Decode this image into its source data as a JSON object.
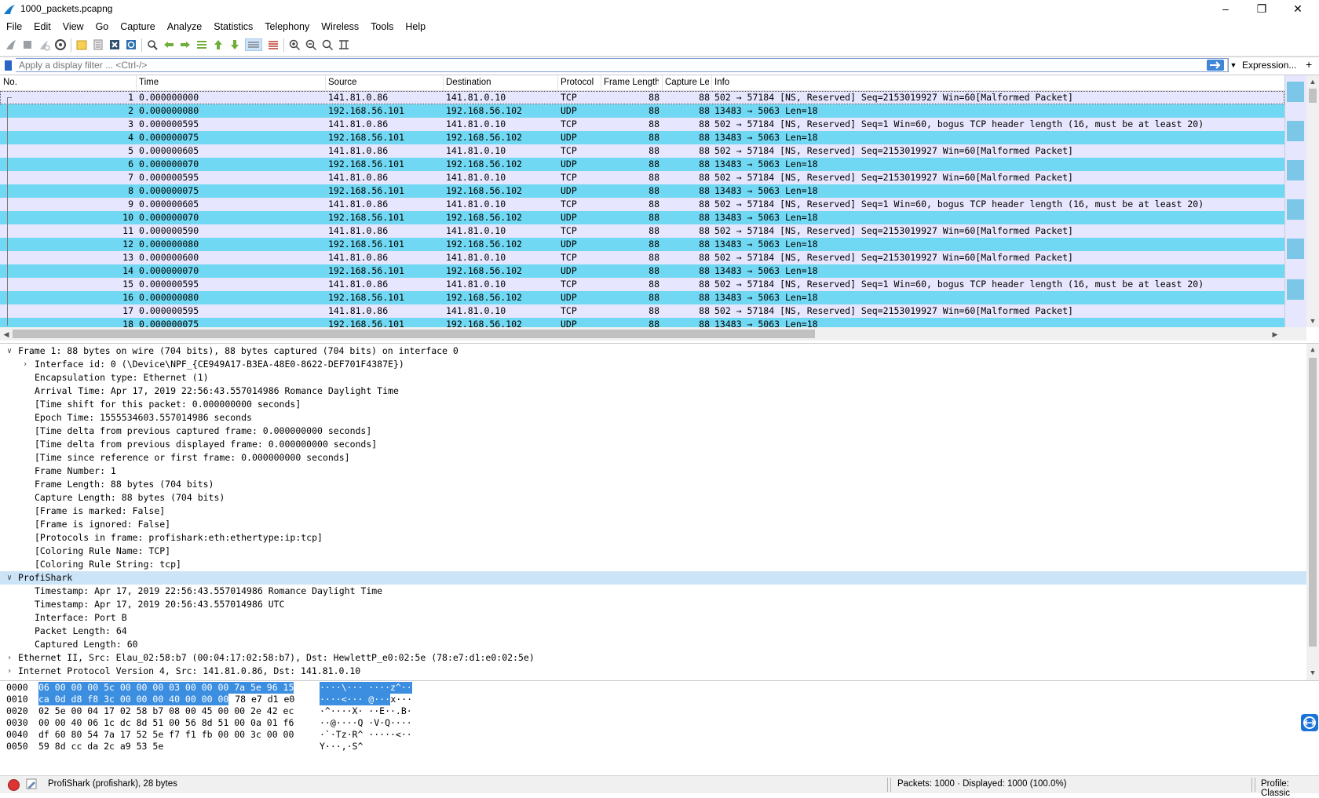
{
  "window": {
    "title": "1000_packets.pcapng"
  },
  "menu": [
    "File",
    "Edit",
    "View",
    "Go",
    "Capture",
    "Analyze",
    "Statistics",
    "Telephony",
    "Wireless",
    "Tools",
    "Help"
  ],
  "filter": {
    "placeholder": "Apply a display filter ... <Ctrl-/>",
    "expression_label": "Expression...",
    "plus_label": "+"
  },
  "packet_list": {
    "columns": [
      "No.",
      "Time",
      "Source",
      "Destination",
      "Protocol",
      "Frame Length",
      "Capture Le",
      "Info"
    ],
    "rows": [
      {
        "no": "1",
        "time": "0.000000000",
        "src": "141.81.0.86",
        "dst": "141.81.0.10",
        "proto": "TCP",
        "flen": "88",
        "clen": "88",
        "info": "502 → 57184 [NS, Reserved] Seq=2153019927 Win=60[Malformed Packet]"
      },
      {
        "no": "2",
        "time": "0.000000080",
        "src": "192.168.56.101",
        "dst": "192.168.56.102",
        "proto": "UDP",
        "flen": "88",
        "clen": "88",
        "info": "13483 → 5063 Len=18"
      },
      {
        "no": "3",
        "time": "0.000000595",
        "src": "141.81.0.86",
        "dst": "141.81.0.10",
        "proto": "TCP",
        "flen": "88",
        "clen": "88",
        "info": "502 → 57184 [NS, Reserved] Seq=1 Win=60, bogus TCP header length (16, must be at least 20)"
      },
      {
        "no": "4",
        "time": "0.000000075",
        "src": "192.168.56.101",
        "dst": "192.168.56.102",
        "proto": "UDP",
        "flen": "88",
        "clen": "88",
        "info": "13483 → 5063 Len=18"
      },
      {
        "no": "5",
        "time": "0.000000605",
        "src": "141.81.0.86",
        "dst": "141.81.0.10",
        "proto": "TCP",
        "flen": "88",
        "clen": "88",
        "info": "502 → 57184 [NS, Reserved] Seq=2153019927 Win=60[Malformed Packet]"
      },
      {
        "no": "6",
        "time": "0.000000070",
        "src": "192.168.56.101",
        "dst": "192.168.56.102",
        "proto": "UDP",
        "flen": "88",
        "clen": "88",
        "info": "13483 → 5063 Len=18"
      },
      {
        "no": "7",
        "time": "0.000000595",
        "src": "141.81.0.86",
        "dst": "141.81.0.10",
        "proto": "TCP",
        "flen": "88",
        "clen": "88",
        "info": "502 → 57184 [NS, Reserved] Seq=2153019927 Win=60[Malformed Packet]"
      },
      {
        "no": "8",
        "time": "0.000000075",
        "src": "192.168.56.101",
        "dst": "192.168.56.102",
        "proto": "UDP",
        "flen": "88",
        "clen": "88",
        "info": "13483 → 5063 Len=18"
      },
      {
        "no": "9",
        "time": "0.000000605",
        "src": "141.81.0.86",
        "dst": "141.81.0.10",
        "proto": "TCP",
        "flen": "88",
        "clen": "88",
        "info": "502 → 57184 [NS, Reserved] Seq=1 Win=60, bogus TCP header length (16, must be at least 20)"
      },
      {
        "no": "10",
        "time": "0.000000070",
        "src": "192.168.56.101",
        "dst": "192.168.56.102",
        "proto": "UDP",
        "flen": "88",
        "clen": "88",
        "info": "13483 → 5063 Len=18"
      },
      {
        "no": "11",
        "time": "0.000000590",
        "src": "141.81.0.86",
        "dst": "141.81.0.10",
        "proto": "TCP",
        "flen": "88",
        "clen": "88",
        "info": "502 → 57184 [NS, Reserved] Seq=2153019927 Win=60[Malformed Packet]"
      },
      {
        "no": "12",
        "time": "0.000000080",
        "src": "192.168.56.101",
        "dst": "192.168.56.102",
        "proto": "UDP",
        "flen": "88",
        "clen": "88",
        "info": "13483 → 5063 Len=18"
      },
      {
        "no": "13",
        "time": "0.000000600",
        "src": "141.81.0.86",
        "dst": "141.81.0.10",
        "proto": "TCP",
        "flen": "88",
        "clen": "88",
        "info": "502 → 57184 [NS, Reserved] Seq=2153019927 Win=60[Malformed Packet]"
      },
      {
        "no": "14",
        "time": "0.000000070",
        "src": "192.168.56.101",
        "dst": "192.168.56.102",
        "proto": "UDP",
        "flen": "88",
        "clen": "88",
        "info": "13483 → 5063 Len=18"
      },
      {
        "no": "15",
        "time": "0.000000595",
        "src": "141.81.0.86",
        "dst": "141.81.0.10",
        "proto": "TCP",
        "flen": "88",
        "clen": "88",
        "info": "502 → 57184 [NS, Reserved] Seq=1 Win=60, bogus TCP header length (16, must be at least 20)"
      },
      {
        "no": "16",
        "time": "0.000000080",
        "src": "192.168.56.101",
        "dst": "192.168.56.102",
        "proto": "UDP",
        "flen": "88",
        "clen": "88",
        "info": "13483 → 5063 Len=18"
      },
      {
        "no": "17",
        "time": "0.000000595",
        "src": "141.81.0.86",
        "dst": "141.81.0.10",
        "proto": "TCP",
        "flen": "88",
        "clen": "88",
        "info": "502 → 57184 [NS, Reserved] Seq=2153019927 Win=60[Malformed Packet]"
      },
      {
        "no": "18",
        "time": "0.000000075",
        "src": "192.168.56.101",
        "dst": "192.168.56.102",
        "proto": "UDP",
        "flen": "88",
        "clen": "88",
        "info": "13483 → 5063 Len=18"
      }
    ]
  },
  "details": [
    {
      "level": 0,
      "twisty": "open",
      "text": "Frame 1: 88 bytes on wire (704 bits), 88 bytes captured (704 bits) on interface 0"
    },
    {
      "level": 1,
      "twisty": "closed",
      "text": "Interface id: 0 (\\Device\\NPF_{CE949A17-B3EA-48E0-8622-DEF701F4387E})"
    },
    {
      "level": 1,
      "twisty": "",
      "text": "Encapsulation type: Ethernet (1)"
    },
    {
      "level": 1,
      "twisty": "",
      "text": "Arrival Time: Apr 17, 2019 22:56:43.557014986 Romance Daylight Time"
    },
    {
      "level": 1,
      "twisty": "",
      "text": "[Time shift for this packet: 0.000000000 seconds]"
    },
    {
      "level": 1,
      "twisty": "",
      "text": "Epoch Time: 1555534603.557014986 seconds"
    },
    {
      "level": 1,
      "twisty": "",
      "text": "[Time delta from previous captured frame: 0.000000000 seconds]"
    },
    {
      "level": 1,
      "twisty": "",
      "text": "[Time delta from previous displayed frame: 0.000000000 seconds]"
    },
    {
      "level": 1,
      "twisty": "",
      "text": "[Time since reference or first frame: 0.000000000 seconds]"
    },
    {
      "level": 1,
      "twisty": "",
      "text": "Frame Number: 1"
    },
    {
      "level": 1,
      "twisty": "",
      "text": "Frame Length: 88 bytes (704 bits)"
    },
    {
      "level": 1,
      "twisty": "",
      "text": "Capture Length: 88 bytes (704 bits)"
    },
    {
      "level": 1,
      "twisty": "",
      "text": "[Frame is marked: False]"
    },
    {
      "level": 1,
      "twisty": "",
      "text": "[Frame is ignored: False]"
    },
    {
      "level": 1,
      "twisty": "",
      "text": "[Protocols in frame: profishark:eth:ethertype:ip:tcp]"
    },
    {
      "level": 1,
      "twisty": "",
      "text": "[Coloring Rule Name: TCP]"
    },
    {
      "level": 1,
      "twisty": "",
      "text": "[Coloring Rule String: tcp]"
    },
    {
      "level": 0,
      "twisty": "open",
      "text": "ProfiShark",
      "selected": true
    },
    {
      "level": 1,
      "twisty": "",
      "text": "Timestamp: Apr 17, 2019 22:56:43.557014986 Romance Daylight Time"
    },
    {
      "level": 1,
      "twisty": "",
      "text": "Timestamp: Apr 17, 2019 20:56:43.557014986 UTC"
    },
    {
      "level": 1,
      "twisty": "",
      "text": "Interface: Port B"
    },
    {
      "level": 1,
      "twisty": "",
      "text": "Packet Length: 64"
    },
    {
      "level": 1,
      "twisty": "",
      "text": "Captured Length: 60"
    },
    {
      "level": 0,
      "twisty": "closed",
      "text": "Ethernet II, Src: Elau_02:58:b7 (00:04:17:02:58:b7), Dst: HewlettP_e0:02:5e (78:e7:d1:e0:02:5e)"
    },
    {
      "level": 0,
      "twisty": "closed",
      "text": "Internet Protocol Version 4, Src: 141.81.0.86, Dst: 141.81.0.10"
    }
  ],
  "bytes": [
    {
      "offset": "0000",
      "hex_hl": "06 00 00 00 5c 00 00 00  03 00 00 00 7a 5e 96 15",
      "hex_rest": "",
      "ascii_hl": "····\\··· ····z^··",
      "ascii_rest": ""
    },
    {
      "offset": "0010",
      "hex_hl": "ca 0d d8 f8 3c 00 00 00  40 00 00 00",
      "hex_rest": " 78 e7 d1 e0",
      "ascii_hl": "····<··· @···",
      "ascii_rest": "x···"
    },
    {
      "offset": "0020",
      "hex_hl": "",
      "hex_rest": "02 5e 00 04 17 02 58 b7  08 00 45 00 00 2e 42 ec",
      "ascii_hl": "",
      "ascii_rest": "·^····X· ··E··.B·"
    },
    {
      "offset": "0030",
      "hex_hl": "",
      "hex_rest": "00 00 40 06 1c dc 8d 51  00 56 8d 51 00 0a 01 f6",
      "ascii_hl": "",
      "ascii_rest": "··@····Q ·V·Q····"
    },
    {
      "offset": "0040",
      "hex_hl": "",
      "hex_rest": "df 60 80 54 7a 17 52 5e  f7 f1 fb 00 00 3c 00 00",
      "ascii_hl": "",
      "ascii_rest": "·`·Tz·R^ ·····<··"
    },
    {
      "offset": "0050",
      "hex_hl": "",
      "hex_rest": "59 8d cc da 2c a9 53 5e",
      "ascii_hl": "",
      "ascii_rest": "Y···,·S^"
    }
  ],
  "status": {
    "left": "ProfiShark (profishark), 28 bytes",
    "packets": "Packets: 1000 · Displayed: 1000 (100.0%)",
    "profile": "Profile: Classic"
  },
  "colors": {
    "tcp_row": "#e7e6ff",
    "udp_row": "#70d8f2",
    "selection": "#cce4f7",
    "byte_highlight": "#3c8fe0"
  }
}
